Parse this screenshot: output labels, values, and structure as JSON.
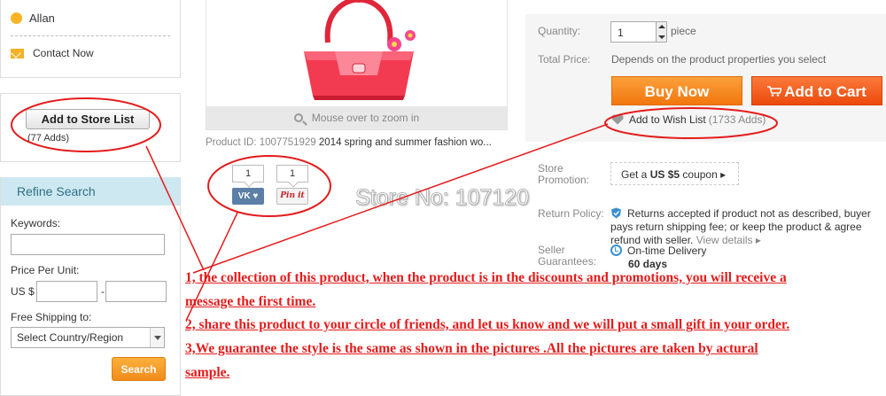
{
  "sidebar": {
    "seller_name": "Allan",
    "contact_label": "Contact Now",
    "store_list_button": "Add to Store List",
    "store_list_adds": "(77 Adds)",
    "refine_title": "Refine Search",
    "keywords_label": "Keywords:",
    "price_label": "Price Per Unit:",
    "currency": "US $",
    "price_separator": "-",
    "shipping_label": "Free Shipping to:",
    "country_select": "Select Country/Region",
    "search_button": "Search"
  },
  "product": {
    "zoom_hint": "Mouse over to zoom in",
    "id_label": "Product ID:",
    "id_value": "1007751929",
    "title": "2014 spring and summer fashion wo..."
  },
  "share": {
    "vk_count": "1",
    "pin_count": "1",
    "vk_label": "VK",
    "pin_label": "Pin it"
  },
  "purchase": {
    "quantity_label": "Quantity:",
    "quantity_value": "1",
    "quantity_unit": "piece",
    "total_label": "Total Price:",
    "total_value": "Depends on the product properties you select",
    "buy_now": "Buy Now",
    "add_to_cart": "Add to Cart",
    "wishlist_label": "Add to Wish List",
    "wishlist_count": "(1733 Adds)"
  },
  "details": {
    "promotion_label": "Store Promotion:",
    "coupon_prefix": "Get a",
    "coupon_amount": "US $5",
    "coupon_suffix": "coupon ▸",
    "return_label": "Return Policy:",
    "return_text": "Returns accepted if product not as described, buyer pays return shipping fee; or keep the product & agree refund with seller.",
    "view_details": "View details ▸",
    "guarantee_label": "Seller Guarantees:",
    "delivery_text": "On-time Delivery",
    "delivery_days": "60 days"
  },
  "watermark": "Store No: 107120",
  "notes": [
    "1, the collection of this product, when the product is in the discounts and promotions, you will receive a",
    "message the first time.",
    "2, share this product to your circle of friends, and let us know and we will put a small gift in your order.",
    "3,We guarantee the style is the same as shown in the pictures .All the pictures are taken by actural",
    "sample."
  ],
  "colors": {
    "annotation_red": "#e51b1b",
    "buy_orange": "#f2760d",
    "cart_orange": "#ec4a0c",
    "refine_header_bg": "#cde8f0"
  },
  "icons": [
    "seller-dot-icon",
    "envelope-icon",
    "magnifier-icon",
    "cart-icon",
    "heart-icon",
    "shield-icon",
    "clock-icon",
    "handbag-product-image"
  ]
}
